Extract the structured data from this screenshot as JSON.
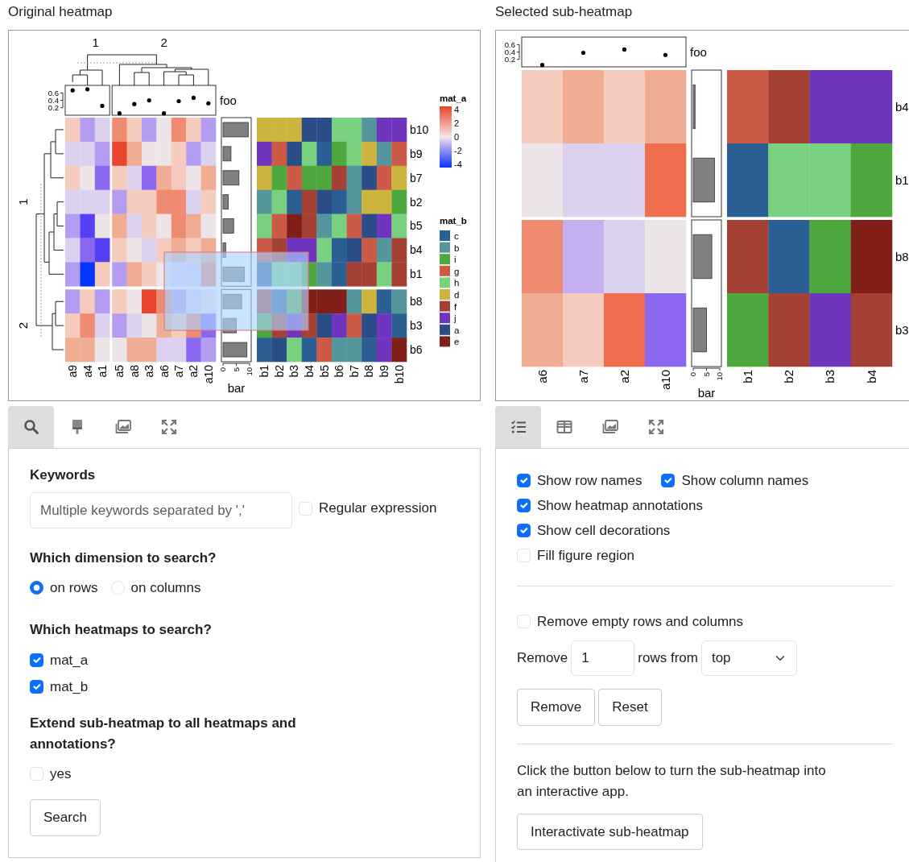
{
  "panels": [
    {
      "title": "Original heatmap",
      "brush_selection": true,
      "heatmap": {
        "column_groups": [
          {
            "label": "1",
            "columns": [
              "a9",
              "a4",
              "a1"
            ]
          },
          {
            "label": "2",
            "columns": [
              "a5",
              "a8",
              "a3",
              "a6",
              "a7",
              "a2",
              "a10"
            ]
          }
        ],
        "row_groups": [
          {
            "label": "1",
            "rows": [
              "b10",
              "b9",
              "b7",
              "b2",
              "b5",
              "b4",
              "b1"
            ]
          },
          {
            "label": "2",
            "rows": [
              "b8",
              "b3",
              "b6"
            ]
          }
        ],
        "mat_b_columns": [
          "b1",
          "b2",
          "b3",
          "b4",
          "b5",
          "b6",
          "b7",
          "b8",
          "b9",
          "b10"
        ],
        "foo": {
          "label": "foo",
          "ticks": [
            "0.6",
            "0.4",
            "0.2"
          ]
        },
        "bar": {
          "label": "bar",
          "ticks": [
            "0",
            "5",
            "10"
          ]
        },
        "legends": [
          {
            "kind": "gradient",
            "title": "mat_a",
            "ticks": [
              "4",
              "2",
              "0",
              "-2",
              "-4"
            ]
          },
          {
            "kind": "discrete",
            "title": "mat_b",
            "items": [
              {
                "label": "c",
                "color": "#2b5f94"
              },
              {
                "label": "b",
                "color": "#55959c"
              },
              {
                "label": "i",
                "color": "#4ea83d"
              },
              {
                "label": "g",
                "color": "#cd5a47"
              },
              {
                "label": "h",
                "color": "#77d17e"
              },
              {
                "label": "d",
                "color": "#cdb43e"
              },
              {
                "label": "f",
                "color": "#a54034"
              },
              {
                "label": "j",
                "color": "#7035bf"
              },
              {
                "label": "a",
                "color": "#2a4d87"
              },
              {
                "label": "e",
                "color": "#801e18"
              }
            ]
          }
        ]
      },
      "tabs": [
        {
          "kind": "search",
          "selected": true
        },
        {
          "kind": "brush",
          "selected": false
        },
        {
          "kind": "image",
          "selected": false
        },
        {
          "kind": "expand",
          "selected": false
        }
      ]
    },
    {
      "title": "Selected sub-heatmap",
      "heatmap": {
        "column_groups": [
          {
            "columns": [
              "a6",
              "a7",
              "a2",
              "a10"
            ]
          }
        ],
        "row_groups": [
          {
            "rows": [
              "b4",
              "b1"
            ]
          },
          {
            "rows": [
              "b8",
              "b3"
            ]
          }
        ],
        "mat_b_columns": [
          "b1",
          "b2",
          "b3",
          "b4"
        ],
        "foo": {
          "label": "foo",
          "ticks": [
            "0.6",
            "0.4",
            "0.2"
          ]
        },
        "bar": {
          "label": "bar",
          "ticks": [
            "0",
            "5",
            "10"
          ]
        }
      },
      "tabs": [
        {
          "kind": "checklist",
          "selected": true
        },
        {
          "kind": "table",
          "selected": false
        },
        {
          "kind": "image",
          "selected": false
        },
        {
          "kind": "expand",
          "selected": false
        }
      ]
    }
  ],
  "search_form": {
    "keywords_label": "Keywords",
    "keywords_placeholder": "Multiple keywords separated by ','",
    "regex": {
      "label": "Regular expression",
      "checked": false
    },
    "dimension_label": "Which dimension to search?",
    "dimension_options": [
      {
        "label": "on rows",
        "selected": true
      },
      {
        "label": "on columns",
        "selected": false
      }
    ],
    "heatmaps_label": "Which heatmaps to search?",
    "heatmaps": [
      {
        "label": "mat_a",
        "checked": true
      },
      {
        "label": "mat_b",
        "checked": true
      }
    ],
    "extend_label": "Extend sub-heatmap to all heatmaps and annotations?",
    "extend": {
      "label": "yes",
      "checked": false
    },
    "button": "Search"
  },
  "settings_form": {
    "options": [
      [
        {
          "label": "Show row names",
          "checked": true
        },
        {
          "label": "Show column names",
          "checked": true
        }
      ],
      [
        {
          "label": "Show heatmap annotations",
          "checked": true
        }
      ],
      [
        {
          "label": "Show cell decorations",
          "checked": true
        }
      ],
      [
        {
          "label": "Fill figure region",
          "checked": false
        }
      ]
    ],
    "remove_empty": {
      "label": "Remove empty rows and columns",
      "checked": false
    },
    "remove_prefix": "Remove",
    "remove_count": "1",
    "remove_middle": "rows from",
    "remove_side": "top",
    "buttons": [
      "Remove",
      "Reset"
    ],
    "note": "Click the button below to turn the sub-heatmap into an interactive app.",
    "interactivate_button": "Interactivate sub-heatmap"
  }
}
